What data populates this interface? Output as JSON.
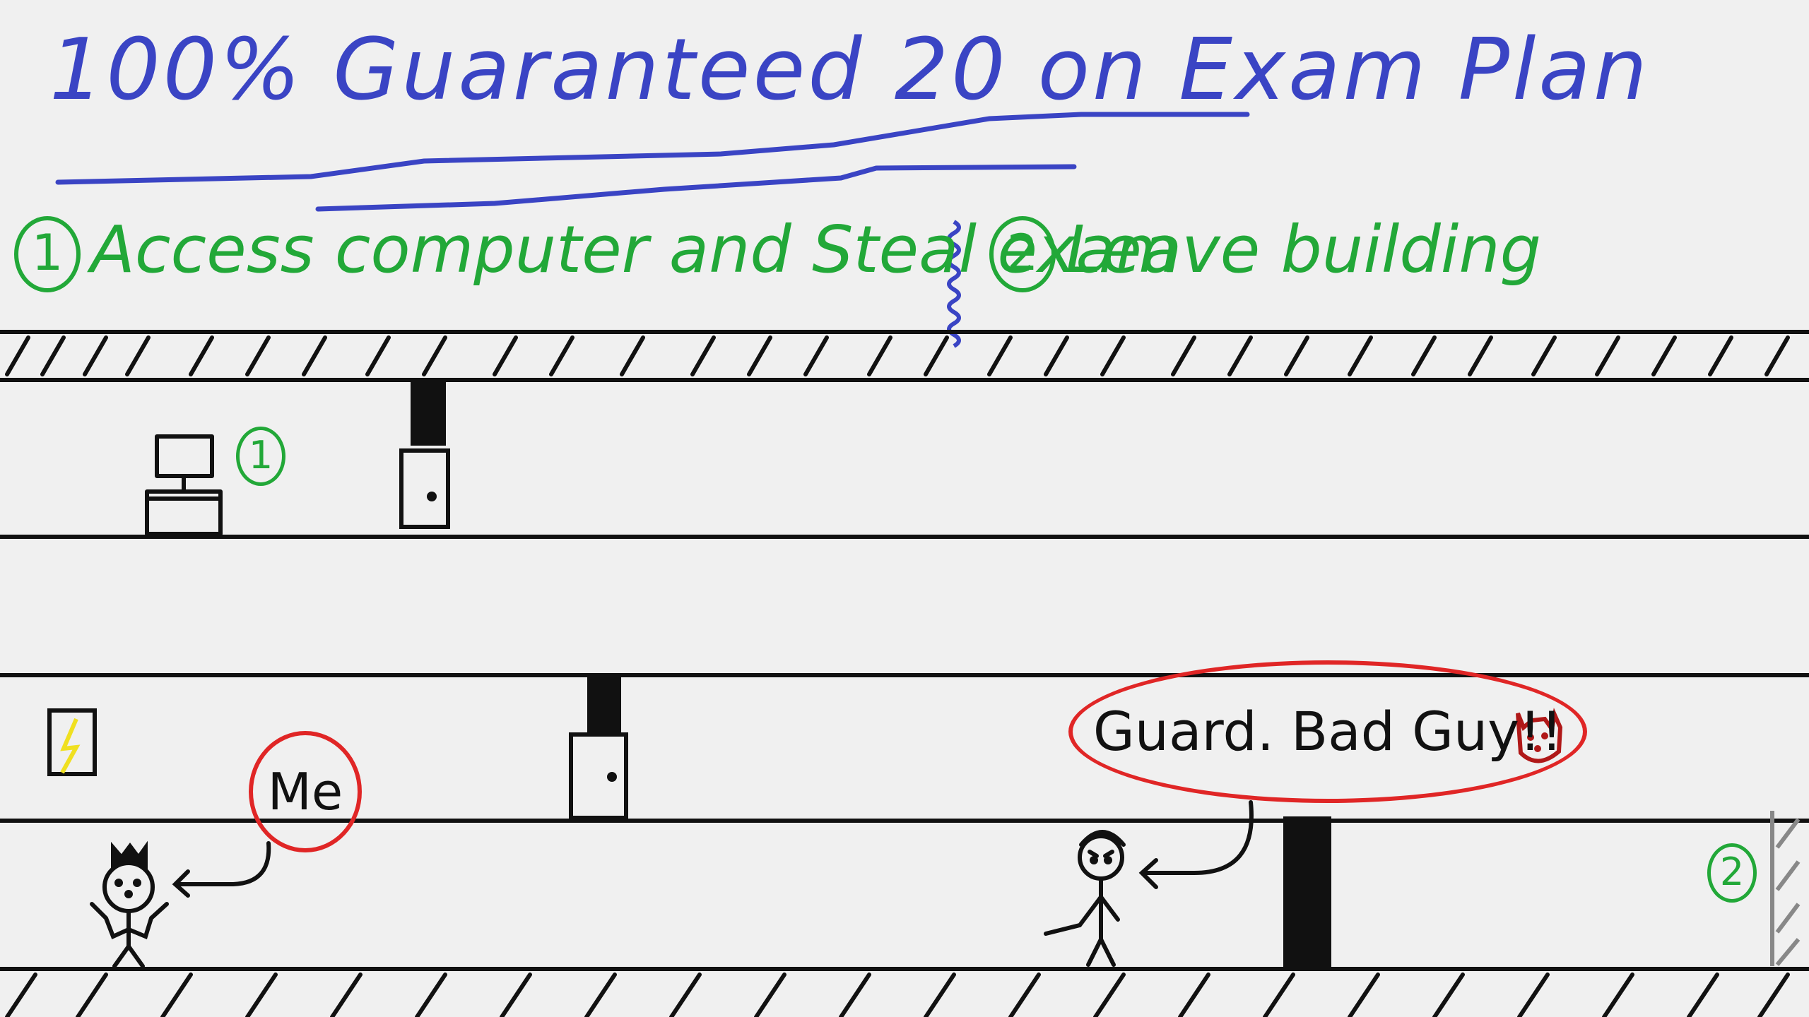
{
  "title": "100% Guaranteed 20 on Exam Plan",
  "steps": [
    {
      "number": "1",
      "text": "Access computer and Steal exam"
    },
    {
      "number": "2",
      "text": "Leave building"
    }
  ],
  "map_markers": {
    "computer_marker": "1",
    "exit_marker": "2"
  },
  "labels": {
    "me": "Me",
    "guard": "Guard. Bad Guy!!"
  },
  "colors": {
    "title": "#3a44c4",
    "steps": "#22a838",
    "callout": "#e02626",
    "ink": "#111111",
    "lightning": "#f0e020",
    "angry_face": "#b01818"
  }
}
